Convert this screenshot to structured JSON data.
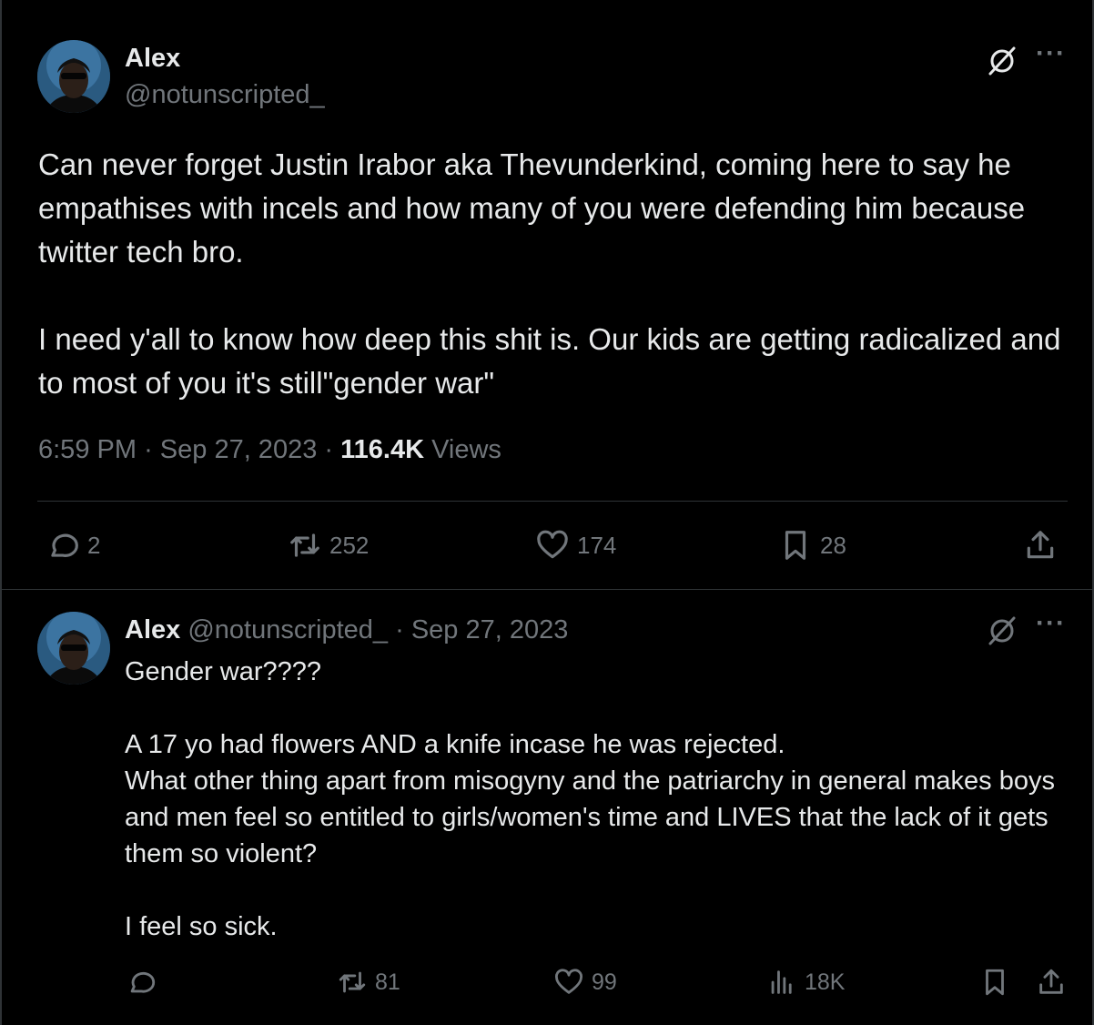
{
  "main_tweet": {
    "author_name": "Alex",
    "author_handle": "@notunscripted_",
    "paragraphs": [
      "Can never forget Justin Irabor aka Thevunderkind, coming here to say he empathises with incels and how many of you were defending him because twitter tech bro.",
      "I need y'all to know how deep this shit is. Our kids are getting radicalized and to most of you it's still\"gender war\""
    ],
    "time": "6:59 PM",
    "date": "Sep 27, 2023",
    "views_count": "116.4K",
    "views_label": "Views",
    "replies": "2",
    "reposts": "252",
    "likes": "174",
    "bookmarks": "28"
  },
  "reply_tweet": {
    "author_name": "Alex",
    "author_handle": "@notunscripted_",
    "separator": "·",
    "date": "Sep 27, 2023",
    "paragraphs": [
      "Gender war????",
      "A 17 yo had flowers AND a knife incase he was rejected.\nWhat other thing apart from misogyny and the patriarchy in general makes boys and men feel so entitled to girls/women's time and LIVES that the lack of it gets them so violent?",
      "I feel so sick."
    ],
    "reposts": "81",
    "likes": "99",
    "views": "18K"
  },
  "more_label": "···",
  "colors": {
    "background": "#000000",
    "text": "#e7e9ea",
    "secondary": "#71767b",
    "border": "#2f3336"
  },
  "icons": [
    "grok-icon",
    "more-icon",
    "reply-icon",
    "repost-icon",
    "like-icon",
    "bookmark-icon",
    "share-icon",
    "views-icon"
  ]
}
